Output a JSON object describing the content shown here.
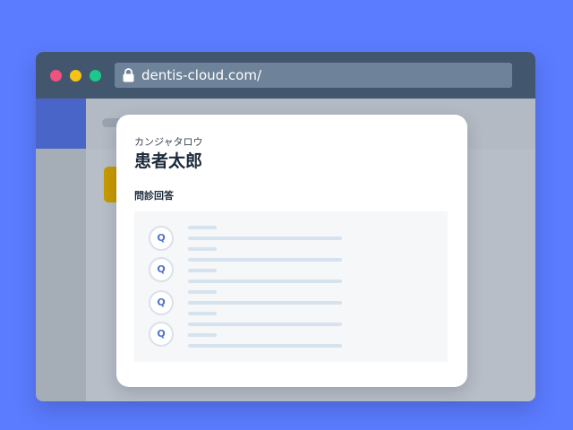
{
  "browser": {
    "url": "dentis-cloud.com/",
    "colors": {
      "background": "#5b7cff",
      "titlebar": "#42566e",
      "close_dot": "#f0517f",
      "minimize_dot": "#f6c417",
      "maximize_dot": "#1cc98b"
    }
  },
  "modal": {
    "patient_kana": "カンジャタロウ",
    "patient_name": "患者太郎",
    "section_title": "問診回答",
    "questions": [
      {
        "badge": "Q"
      },
      {
        "badge": "Q"
      },
      {
        "badge": "Q"
      },
      {
        "badge": "Q"
      }
    ]
  }
}
